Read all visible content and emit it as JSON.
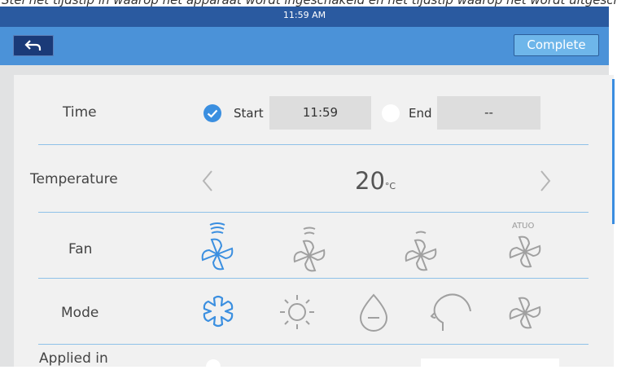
{
  "caption": "Stel het tijdstip in waarop het apparaat wordt ingeschakeld en het tijdstip waarop het wordt uitgeschakeld wanneer de machine wordt uitgeschakeld.",
  "status_bar": {
    "time": "11:59 AM"
  },
  "app_bar": {
    "back_icon": "back-arrow-icon",
    "complete_label": "Complete"
  },
  "rows": {
    "time": {
      "label": "Time",
      "start_label": "Start",
      "start_value": "11:59",
      "start_checked": true,
      "end_label": "End",
      "end_value": "--",
      "end_checked": false
    },
    "temperature": {
      "label": "Temperature",
      "value": "20",
      "unit": "°C"
    },
    "fan": {
      "label": "Fan",
      "options": [
        {
          "icon": "fan-high-icon",
          "selected": true
        },
        {
          "icon": "fan-low-icon",
          "selected": false
        },
        {
          "icon": "fan-off-icon",
          "selected": false
        },
        {
          "icon": "fan-auto-icon",
          "selected": false
        }
      ],
      "auto_label": "ATUO"
    },
    "mode": {
      "label": "Mode",
      "options": [
        {
          "icon": "snowflake-icon",
          "selected": true
        },
        {
          "icon": "sun-icon",
          "selected": false
        },
        {
          "icon": "drop-icon",
          "selected": false
        },
        {
          "icon": "head-icon",
          "selected": false
        },
        {
          "icon": "fan-icon",
          "selected": false
        }
      ]
    },
    "applied": {
      "label": "Applied in"
    }
  },
  "colors": {
    "accent": "#3b8fe0",
    "status_bar": "#2a5aa0",
    "app_bar": "#4b92d8",
    "icon_inactive": "#a0a0a0"
  }
}
